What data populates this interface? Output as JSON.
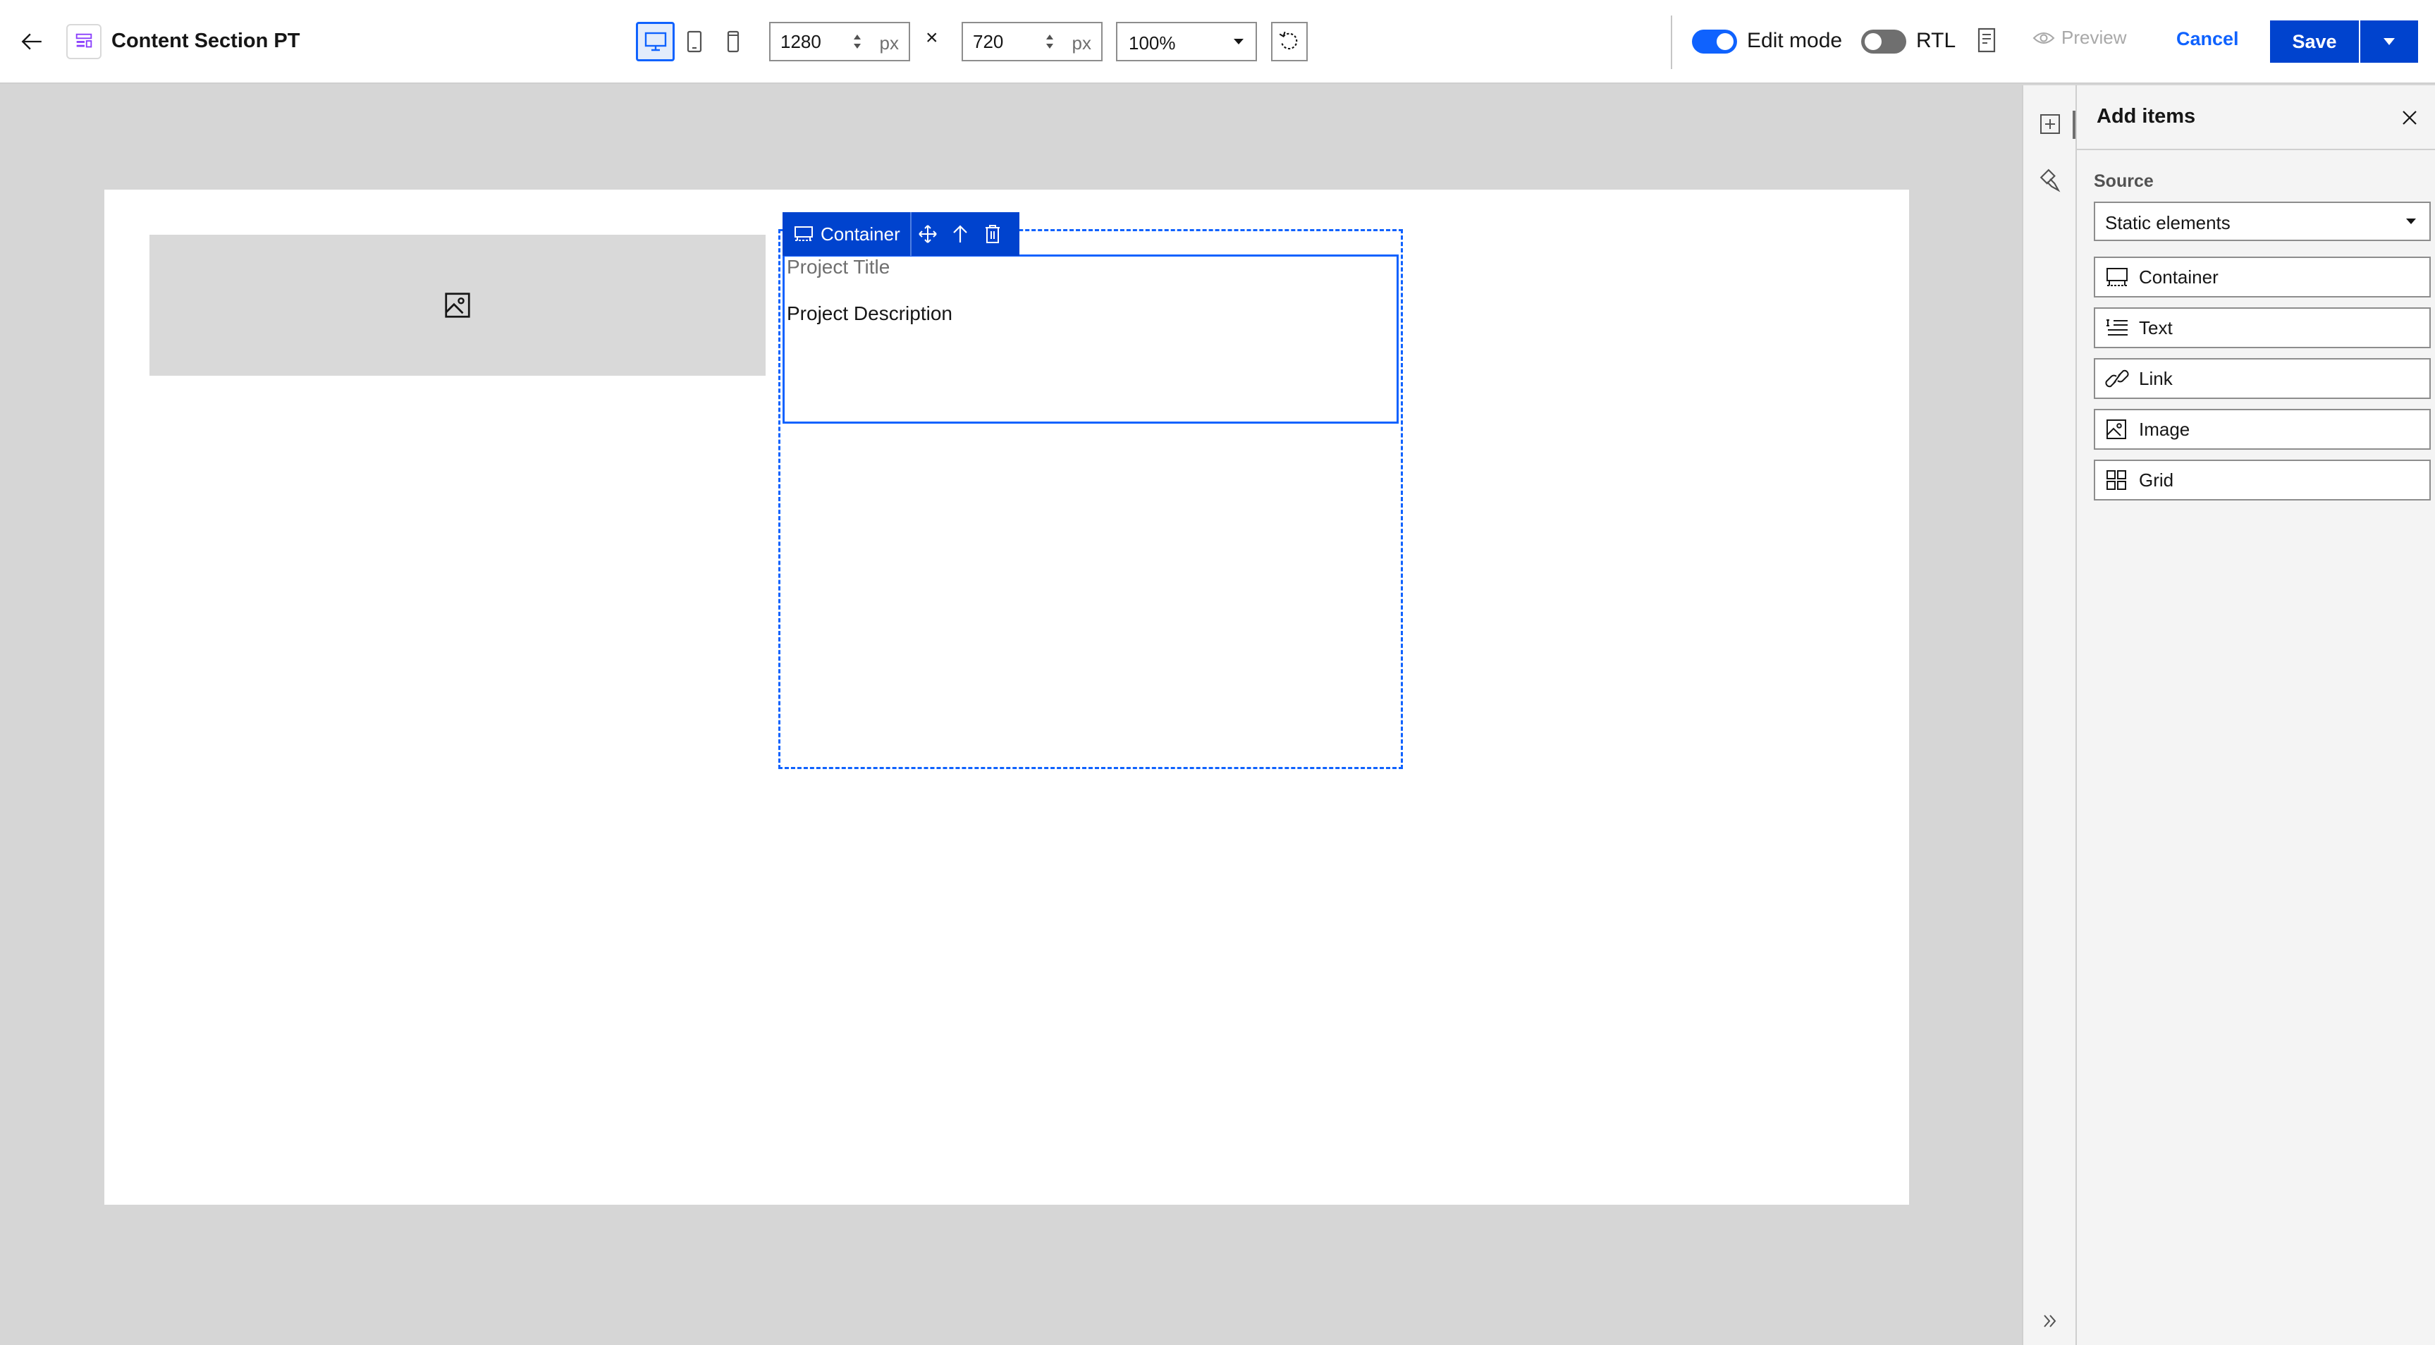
{
  "header": {
    "back_icon": "arrow-left-icon",
    "page_icon": "layout-section-icon",
    "title": "Content Section PT",
    "device_modes": [
      "desktop-icon",
      "tablet-icon",
      "mobile-icon"
    ],
    "active_device": "desktop",
    "width": {
      "value": "1280",
      "unit": "px"
    },
    "times_symbol": "×",
    "height": {
      "value": "720",
      "unit": "px"
    },
    "zoom": "100%",
    "reset_icon": "rotate-reset-icon",
    "edit_mode": {
      "label": "Edit mode",
      "on": true
    },
    "rtl": {
      "label": "RTL",
      "on": false
    },
    "doc_icon": "document-icon",
    "preview_label": "Preview",
    "cancel_label": "Cancel",
    "save_label": "Save"
  },
  "canvas": {
    "image_icon": "image-icon",
    "toolbar": {
      "label": "Container",
      "icons": [
        "container-icon",
        "move-icon",
        "arrow-up-icon",
        "trash-icon"
      ]
    },
    "project_title": "Project Title",
    "project_description": "Project Description"
  },
  "rail": {
    "icons": [
      "add-icon",
      "paint-brush-icon",
      "expand-icon"
    ],
    "active": "add-icon"
  },
  "panel": {
    "title": "Add items",
    "source_label": "Source",
    "source_value": "Static elements",
    "items": [
      {
        "label": "Container",
        "icon": "container-icon"
      },
      {
        "label": "Text",
        "icon": "text-align-icon"
      },
      {
        "label": "Link",
        "icon": "link-icon"
      },
      {
        "label": "Image",
        "icon": "image-icon"
      },
      {
        "label": "Grid",
        "icon": "grid-icon"
      }
    ]
  },
  "colors": {
    "accent": "#0f62fe",
    "save_bg": "#0043ce",
    "canvas_bg": "#d6d6d6",
    "panel_bg": "#f4f4f4",
    "placeholder": "#d9d9d9"
  }
}
